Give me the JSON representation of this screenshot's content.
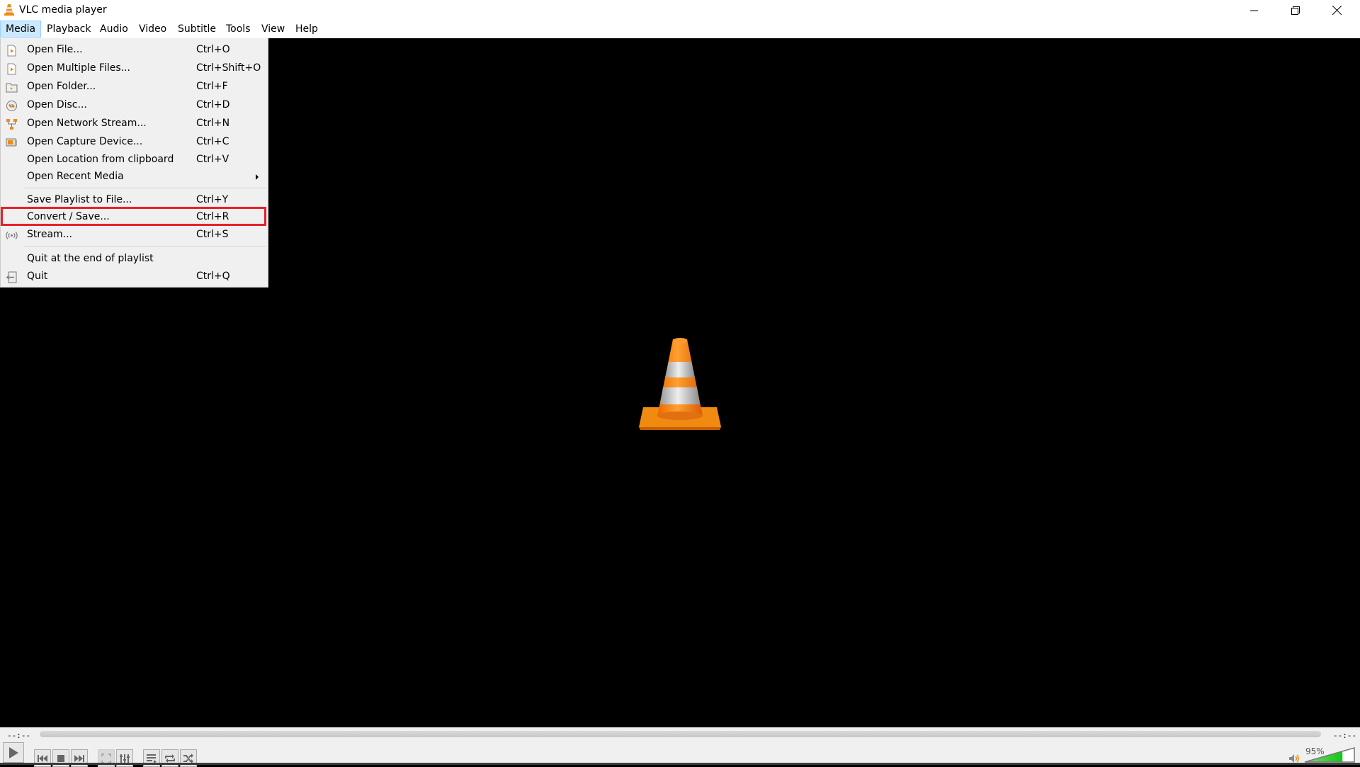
{
  "window": {
    "title": "VLC media player",
    "minimize_icon": "minimize-icon",
    "maximize_icon": "restore-icon",
    "close_icon": "close-icon"
  },
  "menubar": {
    "items": [
      "Media",
      "Playback",
      "Audio",
      "Video",
      "Subtitle",
      "Tools",
      "View",
      "Help"
    ],
    "active": "Media"
  },
  "media_menu": {
    "items": [
      {
        "label": "Open File...",
        "shortcut": "Ctrl+O",
        "icon": "open-file-icon"
      },
      {
        "label": "Open Multiple Files...",
        "shortcut": "Ctrl+Shift+O",
        "icon": "open-multiple-files-icon"
      },
      {
        "label": "Open Folder...",
        "shortcut": "Ctrl+F",
        "icon": "open-folder-icon"
      },
      {
        "label": "Open Disc...",
        "shortcut": "Ctrl+D",
        "icon": "disc-icon"
      },
      {
        "label": "Open Network Stream...",
        "shortcut": "Ctrl+N",
        "icon": "network-icon"
      },
      {
        "label": "Open Capture Device...",
        "shortcut": "Ctrl+C",
        "icon": "capture-device-icon"
      },
      {
        "label": "Open Location from clipboard",
        "shortcut": "Ctrl+V",
        "icon": ""
      },
      {
        "label": "Open Recent Media",
        "shortcut": "",
        "icon": "",
        "submenu": true
      },
      {
        "label": "Save Playlist to File...",
        "shortcut": "Ctrl+Y",
        "icon": ""
      },
      {
        "label": "Convert / Save...",
        "shortcut": "Ctrl+R",
        "icon": "",
        "highlighted": true
      },
      {
        "label": "Stream...",
        "shortcut": "Ctrl+S",
        "icon": "stream-icon"
      },
      {
        "label": "Quit at the end of playlist",
        "shortcut": "",
        "icon": ""
      },
      {
        "label": "Quit",
        "shortcut": "Ctrl+Q",
        "icon": "quit-icon"
      }
    ],
    "highlight_color": "#e8202a"
  },
  "controls": {
    "time_elapsed": "--:--",
    "time_remaining": "--:--",
    "volume_percent": 95,
    "volume_label": "95%",
    "buttons": [
      "play",
      "previous",
      "stop",
      "next",
      "fullscreen",
      "extended-settings",
      "playlist",
      "loop",
      "shuffle"
    ]
  },
  "colors": {
    "accent_orange": "#f28a0c",
    "volume_green": "#1ecb1e",
    "menu_bg": "#f0f0f0",
    "menubar_active_bg": "#cce8ff"
  }
}
